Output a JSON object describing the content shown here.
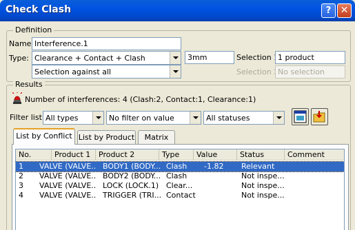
{
  "window": {
    "title": "Check Clash",
    "help_button": "?",
    "close_button": "✕"
  },
  "definition": {
    "legend": "Definition",
    "name_label": "Name:",
    "name_value": "Interference.1",
    "type_label": "Type:",
    "type_value": "Clearance + Contact + Clash",
    "clearance_value": "3mm",
    "mode_value": "Selection against all",
    "selection1_label": "Selection 1:",
    "selection1_value": "1 product",
    "selection2_label": "Selection 2:",
    "selection2_value": "No selection"
  },
  "results": {
    "legend": "Results",
    "summary": "Number of interferences: 4 (Clash:2, Contact:1, Clearance:1)",
    "filter_label": "Filter list:",
    "filter_type": "All types",
    "filter_value": "No filter on value",
    "filter_status": "All statuses",
    "tabs": [
      "List by Conflict",
      "List by Product",
      "Matrix"
    ],
    "columns": [
      "No.",
      "Product 1",
      "Product 2",
      "Type",
      "Value",
      "Status",
      "Comment"
    ],
    "rows": [
      [
        "1",
        "VALVE (VALVE...",
        "BODY1 (BODY...",
        "Clash",
        "-1.82",
        "Relevant",
        ""
      ],
      [
        "2",
        "VALVE (VALVE...",
        "BODY2 (BODY...",
        "Clash",
        "",
        "Not inspe...",
        ""
      ],
      [
        "3",
        "VALVE (VALVE...",
        "LOCK (LOCK.1)",
        "Clear...",
        "",
        "Not inspe...",
        ""
      ],
      [
        "4",
        "VALVE (VALVE...",
        "TRIGGER (TRI...",
        "Contact",
        "",
        "Not inspe...",
        ""
      ]
    ]
  },
  "colors": {
    "title_bar": "#0053e1",
    "selection": "#316ac5",
    "dialog_bg": "#ece9d8"
  }
}
